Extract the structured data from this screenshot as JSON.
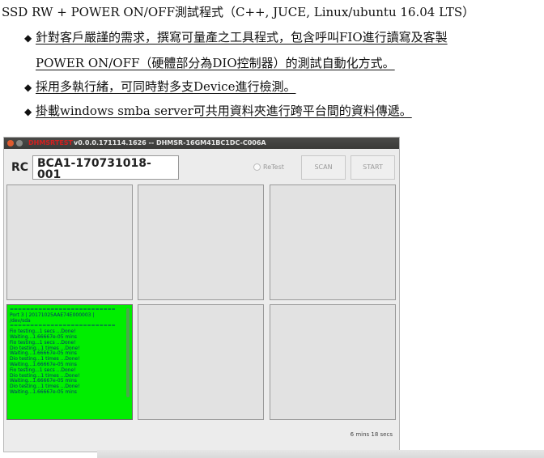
{
  "doc": {
    "heading": "SSD RW + POWER ON/OFF測試程式（C++, JUCE, Linux/ubuntu 16.04 LTS）",
    "bullet_char": "◆",
    "bullets": [
      "針對客戶嚴謹的需求，撰寫可量產之工具程式，包含呼叫FIO進行讀寫及客製",
      "採用多執行緒，可同時對多支Device進行檢測。",
      "掛載windows smba server可共用資料夾進行跨平台間的資料傳遞。"
    ],
    "bullet1_cont": "POWER ON/OFF（硬體部分為DIO控制器）的測試自動化方式。"
  },
  "window": {
    "app_name": "DHMSRTEST",
    "title": "v0.0.0.171114.1626 -- DHMSR-16GM41BC1DC-C006A",
    "rc_label": "RC",
    "serial_value": "BCA1-170731018-001",
    "retest_label": "ReTest",
    "scan_label": "SCAN",
    "start_label": "START",
    "elapsed": "6 mins 18 secs",
    "log_lines": [
      "==========================",
      "Port 3 | 20171025AAE74E000003 |",
      "/dev/sda",
      "==========================",
      "Fio testing...1 secs ...Done!",
      "Waiting...1.66667e-05 mins",
      "Fio testing...1 secs ...Done!",
      "Dio testing...1 times ...Done!",
      "Waiting...1.66667e-05 mins",
      "Dio testing...1 times ...Done!",
      "Waiting...1.66667e-05 mins",
      "Fio testing...1 secs ...Done!",
      "Dio testing...1 times ...Done!",
      "Waiting...1.66667e-05 mins",
      "Dio testing...1 times ...Done!",
      "Waiting...1.66667e-05 mins"
    ]
  },
  "colors": {
    "active_panel": "#00ee00",
    "app_name": "#d41f1f"
  }
}
